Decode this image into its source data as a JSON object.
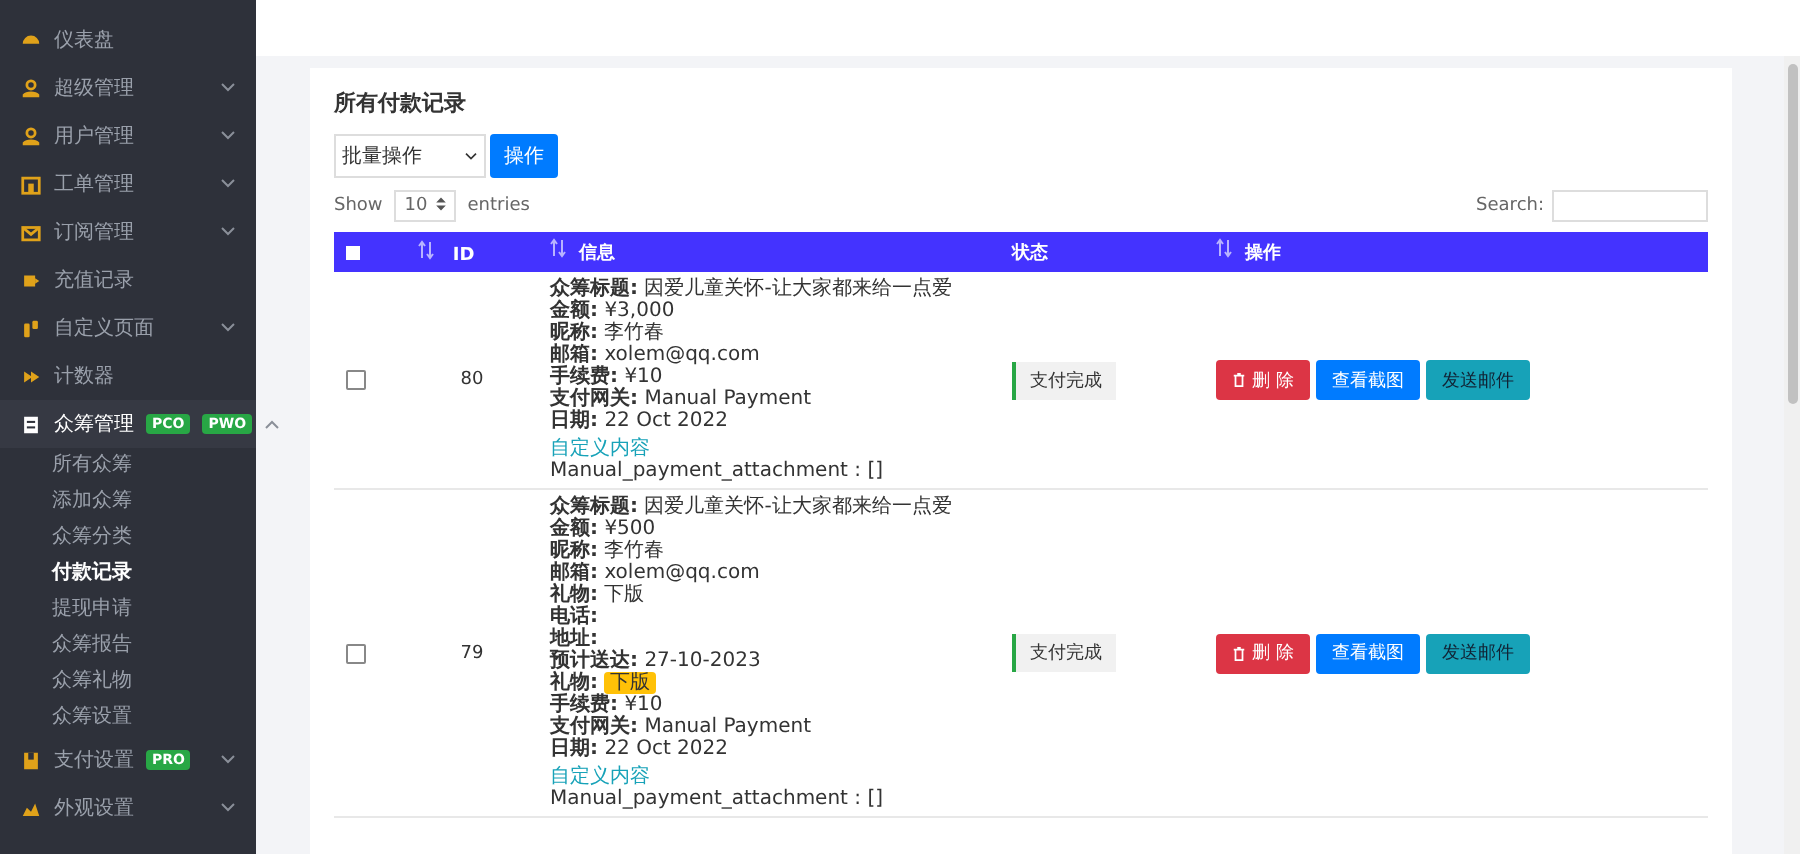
{
  "sidebar": {
    "items": [
      {
        "label": "仪表盘",
        "expandable": false,
        "expanded": false
      },
      {
        "label": "超级管理",
        "expandable": true,
        "expanded": false
      },
      {
        "label": "用户管理",
        "expandable": true,
        "expanded": false
      },
      {
        "label": "工单管理",
        "expandable": true,
        "expanded": false
      },
      {
        "label": "订阅管理",
        "expandable": true,
        "expanded": false
      },
      {
        "label": "充值记录",
        "expandable": false,
        "expanded": false
      },
      {
        "label": "自定义页面",
        "expandable": true,
        "expanded": false
      },
      {
        "label": "计数器",
        "expandable": false,
        "expanded": false
      },
      {
        "label": "众筹管理",
        "expandable": true,
        "expanded": true,
        "badges": [
          "PCO",
          "PWO"
        ],
        "children": [
          {
            "label": "所有众筹",
            "selected": false
          },
          {
            "label": "添加众筹",
            "selected": false
          },
          {
            "label": "众筹分类",
            "selected": false
          },
          {
            "label": "付款记录",
            "selected": true
          },
          {
            "label": "提现申请",
            "selected": false
          },
          {
            "label": "众筹报告",
            "selected": false
          },
          {
            "label": "众筹礼物",
            "selected": false
          },
          {
            "label": "众筹设置",
            "selected": false
          }
        ]
      },
      {
        "label": "支付设置",
        "expandable": true,
        "expanded": false,
        "badges": [
          "PRO"
        ]
      },
      {
        "label": "外观设置",
        "expandable": true,
        "expanded": false
      }
    ]
  },
  "card": {
    "title": "所有付款记录",
    "bulk_select": "批量操作",
    "apply_button": "操作",
    "show_label": "Show",
    "entries_value": "10",
    "entries_label": "entries",
    "search_label": "Search:"
  },
  "table": {
    "select_all_checked": false,
    "columns": [
      "ID",
      "信息",
      "状态",
      "操作"
    ],
    "rows": [
      {
        "checked": false,
        "id": "80",
        "lines": [
          {
            "kind": "field",
            "label": "众筹标题:",
            "value": "因爱儿童关怀-让大家都来给一点爱"
          },
          {
            "kind": "field",
            "label": "金额:",
            "value": "¥3,000"
          },
          {
            "kind": "field",
            "label": "昵称:",
            "value": "李竹春"
          },
          {
            "kind": "field",
            "label": "邮箱:",
            "value": "xolem@qq.com"
          },
          {
            "kind": "field",
            "label": "手续费:",
            "value": "¥10"
          },
          {
            "kind": "field",
            "label": "支付网关:",
            "value": "Manual Payment"
          },
          {
            "kind": "field",
            "label": "日期:",
            "value": "22 Oct 2022"
          },
          {
            "kind": "link",
            "value": "自定义内容"
          },
          {
            "kind": "plain",
            "value": "Manual_payment_attachment : []"
          }
        ],
        "status": {
          "text": "支付完成",
          "kind": "success"
        },
        "actions": [
          {
            "label": "删 除",
            "kind": "danger"
          },
          {
            "label": "查看截图",
            "kind": "primary"
          },
          {
            "label": "发送邮件",
            "kind": "info"
          }
        ]
      },
      {
        "checked": false,
        "id": "79",
        "lines": [
          {
            "kind": "field",
            "label": "众筹标题:",
            "value": "因爱儿童关怀-让大家都来给一点爱"
          },
          {
            "kind": "field",
            "label": "金额:",
            "value": "¥500"
          },
          {
            "kind": "field",
            "label": "昵称:",
            "value": "李竹春"
          },
          {
            "kind": "field",
            "label": "邮箱:",
            "value": "xolem@qq.com"
          },
          {
            "kind": "field",
            "label": "礼物:",
            "value": "下版"
          },
          {
            "kind": "field",
            "label": "电话:"
          },
          {
            "kind": "field",
            "label": "地址:"
          },
          {
            "kind": "field",
            "label": "预计送达:",
            "value": "27-10-2023"
          },
          {
            "kind": "badge",
            "label": "礼物:",
            "value": "下版"
          },
          {
            "kind": "field",
            "label": "手续费:",
            "value": "¥10"
          },
          {
            "kind": "field",
            "label": "支付网关:",
            "value": "Manual Payment"
          },
          {
            "kind": "field",
            "label": "日期:",
            "value": "22 Oct 2022"
          },
          {
            "kind": "link",
            "value": "自定义内容"
          },
          {
            "kind": "plain",
            "value": "Manual_payment_attachment : []"
          }
        ],
        "status": {
          "text": "支付完成",
          "kind": "success"
        },
        "actions": [
          {
            "label": "删 除",
            "kind": "danger"
          },
          {
            "label": "查看截图",
            "kind": "primary"
          },
          {
            "label": "发送邮件",
            "kind": "info"
          }
        ]
      }
    ]
  }
}
